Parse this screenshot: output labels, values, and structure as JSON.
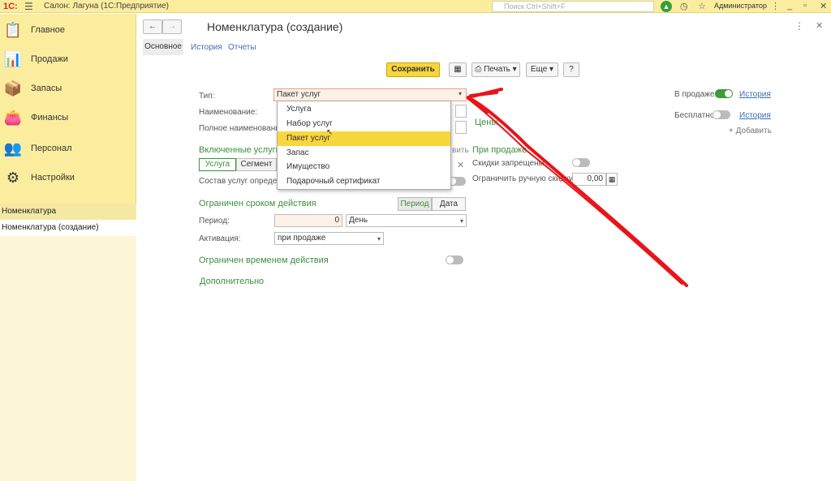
{
  "topbar": {
    "logo": "1С:",
    "app_title": "Салон: Лагуна  (1С:Предприятие)",
    "search_placeholder": "Поиск Ctrl+Shift+F",
    "user": "Администратор"
  },
  "sidebar": {
    "items": [
      {
        "label": "Главное",
        "icon": "clipboard-icon"
      },
      {
        "label": "Продажи",
        "icon": "chart-icon"
      },
      {
        "label": "Запасы",
        "icon": "box-icon"
      },
      {
        "label": "Финансы",
        "icon": "wallet-icon"
      },
      {
        "label": "Персонал",
        "icon": "people-icon"
      },
      {
        "label": "Настройки",
        "icon": "gear-icon"
      }
    ],
    "open_windows": [
      "Номенклатура",
      "Номенклатура (создание)"
    ]
  },
  "form": {
    "title": "Номенклатура (создание)",
    "tabs": [
      "Основное",
      "История",
      "Отчеты"
    ],
    "save": "Сохранить",
    "print": "Печать",
    "more": "Еще",
    "help": "?",
    "type_label": "Тип:",
    "type_value": "Пакет услуг",
    "name_label": "Наименование:",
    "fullname_label": "Полное наименование:",
    "on_sale_label": "В продаже:",
    "history": "История",
    "free_label": "Бесплатно:",
    "add": "+ Добавить",
    "prices": "Цены",
    "included": "Включенные услуги",
    "show": "вить",
    "seg_service": "Услуга",
    "seg_segment": "Сегмент",
    "composition": "Состав услуг определя",
    "on_sale_section": "При продаже",
    "discounts": "Скидки запрещены:",
    "limit_discount": "Ограничить ручную скидку",
    "limit_pct": "(%):",
    "limit_value": "0,00",
    "limited_term": "Ограничен сроком действия",
    "period_btn": "Период",
    "date_btn": "Дата",
    "period_label": "Период:",
    "period_value": "0",
    "period_unit": "День",
    "activation_label": "Активация:",
    "activation_value": "при продаже",
    "limited_time": "Ограничен временем действия",
    "additional": "Дополнительно"
  },
  "dropdown": {
    "options": [
      "Услуга",
      "Набор услуг",
      "Пакет услуг",
      "Запас",
      "Имущество",
      "Подарочный сертификат"
    ],
    "selected": "Пакет услуг"
  },
  "colors": {
    "yellow": "#fbed9e",
    "accent": "#f8d63e",
    "green": "#3d8f3d",
    "annotation": "#e8141a"
  }
}
